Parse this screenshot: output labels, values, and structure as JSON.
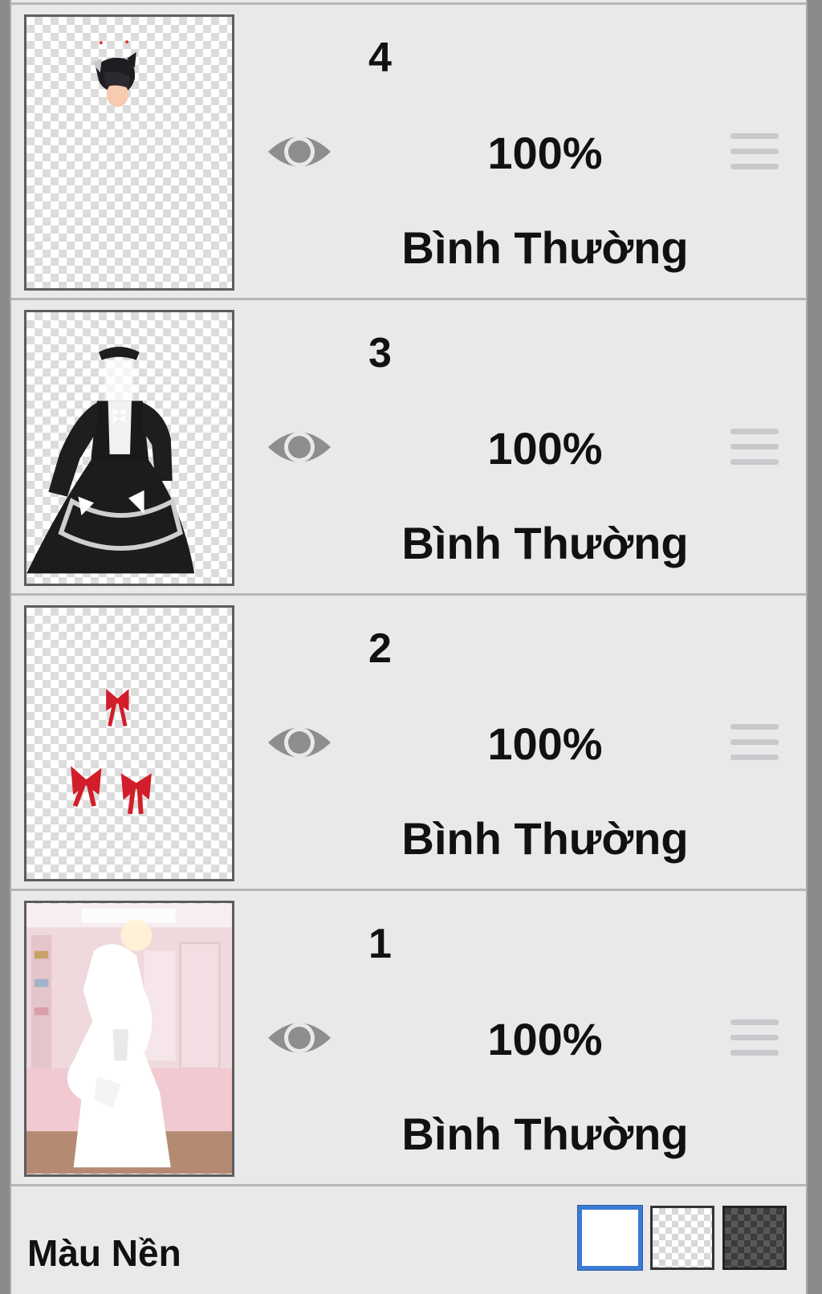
{
  "layers": [
    {
      "number": "4",
      "opacity": "100%",
      "blend_mode": "Bình Thường",
      "visible": true,
      "thumbnail": "character-head-with-cat-ears"
    },
    {
      "number": "3",
      "opacity": "100%",
      "blend_mode": "Bình Thường",
      "visible": true,
      "thumbnail": "black-maid-dress"
    },
    {
      "number": "2",
      "opacity": "100%",
      "blend_mode": "Bình Thường",
      "visible": true,
      "thumbnail": "red-bows"
    },
    {
      "number": "1",
      "opacity": "100%",
      "blend_mode": "Bình Thường",
      "visible": true,
      "thumbnail": "pink-room-background"
    }
  ],
  "footer": {
    "label": "Màu Nền",
    "swatches": [
      {
        "name": "white",
        "selected": true
      },
      {
        "name": "transparent",
        "selected": false
      },
      {
        "name": "dark-checker",
        "selected": false
      }
    ]
  },
  "colors": {
    "accent": "#3a7bd5",
    "panel_bg": "#e9e9e9",
    "eye_icon": "#8e8e8e",
    "handle": "#c9c9cd"
  },
  "icons": {
    "visibility": "eye-icon",
    "reorder": "drag-handle-icon"
  }
}
